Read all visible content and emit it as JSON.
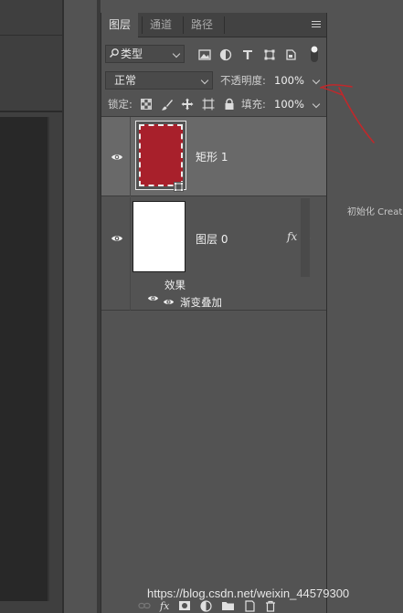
{
  "tabs": [
    "图层",
    "通道",
    "路径"
  ],
  "filter": {
    "label": "类型"
  },
  "blend": {
    "mode": "正常",
    "opacity_label": "不透明度:",
    "opacity_value": "100%"
  },
  "lock": {
    "label": "锁定:",
    "fill_label": "填充:",
    "fill_value": "100%"
  },
  "layers": [
    {
      "name": "矩形 1",
      "thumb_color": "#a8202b"
    },
    {
      "name": "图层 0",
      "thumb_color": "#ffffff",
      "fx": "fx",
      "effects_label": "效果",
      "effect_item": "渐变叠加"
    }
  ],
  "side_text": "初始化 Creat",
  "watermark": "https://blog.csdn.net/weixin_44579300",
  "annotation_color": "#c0282b",
  "icons": [
    "search-icon",
    "image-filter-icon",
    "adjust-filter-icon",
    "type-filter-icon",
    "shape-filter-icon",
    "smart-object-filter-icon",
    "filter-toggle-icon",
    "lock-pixels-icon",
    "lock-brush-icon",
    "lock-position-icon",
    "lock-artboard-icon",
    "lock-all-icon",
    "eye-icon",
    "link-icon",
    "fx-icon",
    "mask-icon",
    "adjustment-icon",
    "folder-icon",
    "new-layer-icon",
    "trash-icon",
    "panel-menu-icon"
  ]
}
